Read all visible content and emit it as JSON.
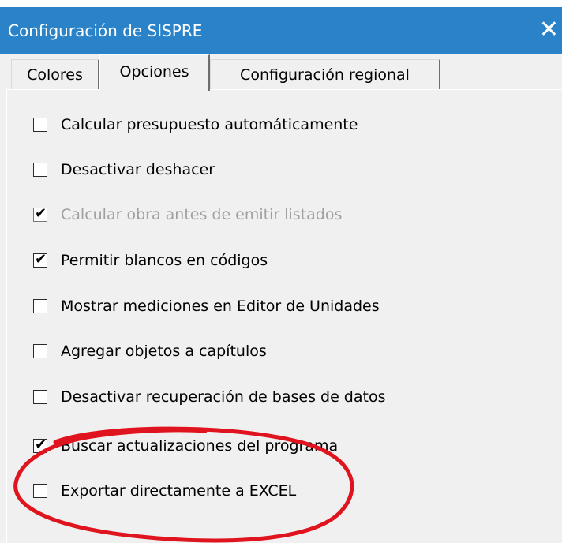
{
  "window": {
    "title": "Configuración de SISPRE",
    "close_glyph": "✕"
  },
  "tabs": [
    {
      "label": "Colores",
      "active": false
    },
    {
      "label": "Opciones",
      "active": true
    },
    {
      "label": "Configuración regional",
      "active": false
    }
  ],
  "options": [
    {
      "label": "Calcular presupuesto automáticamente",
      "checked": false,
      "disabled": false
    },
    {
      "label": "Desactivar deshacer",
      "checked": false,
      "disabled": false
    },
    {
      "label": "Calcular obra antes de emitir listados",
      "checked": true,
      "disabled": true
    },
    {
      "label": "Permitir blancos en códigos",
      "checked": true,
      "disabled": false
    },
    {
      "label": "Mostrar mediciones en Editor de Unidades",
      "checked": false,
      "disabled": false
    },
    {
      "label": "Agregar objetos a capítulos",
      "checked": false,
      "disabled": false
    },
    {
      "label": "Desactivar recuperación de bases de datos",
      "checked": false,
      "disabled": false
    },
    {
      "label": "Buscar actualizaciones del programa",
      "checked": true,
      "disabled": false
    },
    {
      "label": "Exportar directamente a EXCEL",
      "checked": false,
      "disabled": false
    }
  ],
  "colors": {
    "titlebar": "#2a82c8",
    "dialog_bg": "#f0f0f0",
    "annotation_circle": "#e0141e"
  },
  "check_glyph": "✔"
}
